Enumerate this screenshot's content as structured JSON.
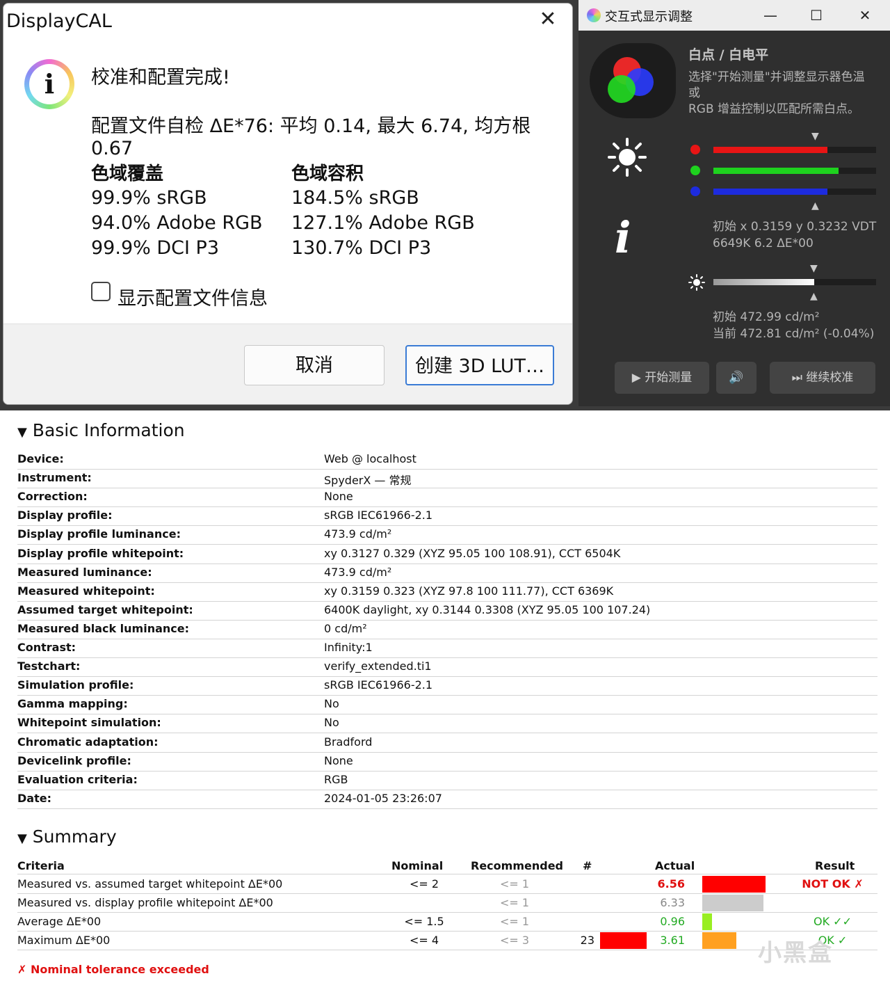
{
  "dialog": {
    "title": "DisplayCAL",
    "close_glyph": "✕",
    "info_glyph": "i",
    "heading": "校准和配置完成!",
    "selfcheck": "配置文件自检 ΔE*76: 平均 0.14, 最大 6.74, 均方根 0.67",
    "coverage": {
      "title": "色域覆盖",
      "items": [
        "99.9% sRGB",
        "94.0% Adobe RGB",
        "99.9% DCI P3"
      ]
    },
    "volume": {
      "title": "色域容积",
      "items": [
        "184.5% sRGB",
        "127.1% Adobe RGB",
        "130.7% DCI P3"
      ]
    },
    "checkbox_label": "显示配置文件信息",
    "checkbox_checked": false,
    "cancel_label": "取消",
    "lut_label": "创建 3D LUT…"
  },
  "adjust": {
    "title": "交互式显示调整",
    "minimize_glyph": "—",
    "maximize_glyph": "☐",
    "close_glyph": "✕",
    "heading": "白点 / 白电平",
    "description": "选择\"开始测量\"并调整显示器色温或\nRGB 增益控制以匹配所需白点。",
    "rgb": [
      {
        "channel": "red",
        "color": "#e81515",
        "level": 0.7
      },
      {
        "channel": "green",
        "color": "#1ed21e",
        "level": 0.77
      },
      {
        "channel": "blue",
        "color": "#1d2bde",
        "level": 0.7
      }
    ],
    "rgb_target_level": 0.63,
    "white_readout": [
      "初始 x 0.3159 y 0.3232 VDT",
      "6649K 6.2 ΔE*00"
    ],
    "luminance_level": 0.62,
    "luminance_target_level": 0.62,
    "luminance_readout": [
      "初始 472.99 cd/m²",
      "当前 472.81 cd/m² (-0.04%)"
    ],
    "btn_start": "开始测量",
    "btn_start_icon": "▶",
    "btn_sound_icon": "🔊",
    "btn_continue": "继续校准",
    "btn_continue_icon": "⏭",
    "arrow_down": "▼",
    "arrow_up": "▲"
  },
  "basic": {
    "title": "Basic Information",
    "toggle": "▼",
    "rows": [
      {
        "label": "Device:",
        "value": "Web @ localhost"
      },
      {
        "label": "Instrument:",
        "value": "SpyderX — 常规"
      },
      {
        "label": "Correction:",
        "value": "None"
      },
      {
        "label": "Display profile:",
        "value": "sRGB IEC61966-2.1"
      },
      {
        "label": "Display profile luminance:",
        "value": "473.9 cd/m²"
      },
      {
        "label": "Display profile whitepoint:",
        "value": "xy 0.3127 0.329 (XYZ 95.05 100 108.91), CCT 6504K"
      },
      {
        "label": "Measured luminance:",
        "value": "473.9 cd/m²"
      },
      {
        "label": "Measured whitepoint:",
        "value": "xy 0.3159 0.323 (XYZ 97.8 100 111.77), CCT 6369K"
      },
      {
        "label": "Assumed target whitepoint:",
        "value": "6400K daylight, xy 0.3144 0.3308 (XYZ 95.05 100 107.24)"
      },
      {
        "label": "Measured black luminance:",
        "value": "0 cd/m²"
      },
      {
        "label": "Contrast:",
        "value": "Infinity:1"
      },
      {
        "label": "Testchart:",
        "value": "verify_extended.ti1"
      },
      {
        "label": "Simulation profile:",
        "value": "sRGB IEC61966-2.1"
      },
      {
        "label": "Gamma mapping:",
        "value": "No"
      },
      {
        "label": "Whitepoint simulation:",
        "value": "No"
      },
      {
        "label": "Chromatic adaptation:",
        "value": "Bradford"
      },
      {
        "label": "Devicelink profile:",
        "value": "None"
      },
      {
        "label": "Evaluation criteria:",
        "value": "RGB"
      },
      {
        "label": "Date:",
        "value": "2024-01-05 23:26:07"
      }
    ]
  },
  "summary": {
    "title": "Summary",
    "toggle": "▼",
    "headers": {
      "criteria": "Criteria",
      "nominal": "Nominal",
      "recommended": "Recommended",
      "count": "#",
      "actual": "Actual",
      "result": "Result"
    },
    "rows": [
      {
        "criteria": "Measured vs. assumed target whitepoint ΔE*00",
        "nominal": "<= 2",
        "recommended": "<= 1",
        "count": "",
        "actual": "6.56",
        "actual_color": "#e01010",
        "actual_bold": true,
        "bar_color": "#ff0000",
        "bar_level": 0.85,
        "count_bar": false,
        "result": "NOT OK ✗",
        "result_color": "#e01010"
      },
      {
        "criteria": "Measured vs. display profile whitepoint ΔE*00",
        "nominal": "",
        "recommended": "<= 1",
        "count": "",
        "actual": "6.33",
        "actual_color": "#888888",
        "actual_bold": false,
        "bar_color": "#cccccc",
        "bar_level": 0.82,
        "count_bar": false,
        "result": "",
        "result_color": "#111111"
      },
      {
        "criteria": "Average ΔE*00",
        "nominal": "<= 1.5",
        "recommended": "<= 1",
        "count": "",
        "actual": "0.96",
        "actual_color": "#22aa22",
        "actual_bold": false,
        "bar_color": "#99ee22",
        "bar_level": 0.13,
        "count_bar": false,
        "result": "OK ✓✓",
        "result_color": "#22aa22"
      },
      {
        "criteria": "Maximum ΔE*00",
        "nominal": "<= 4",
        "recommended": "<= 3",
        "count": "23",
        "actual": "3.61",
        "actual_color": "#22aa22",
        "actual_bold": false,
        "bar_color": "#ffa020",
        "bar_level": 0.46,
        "count_bar": true,
        "result": "OK ✓",
        "result_color": "#22aa22"
      }
    ],
    "footer": "✗ Nominal tolerance exceeded",
    "footer_color": "#e01010"
  },
  "watermark": "小黑盒"
}
